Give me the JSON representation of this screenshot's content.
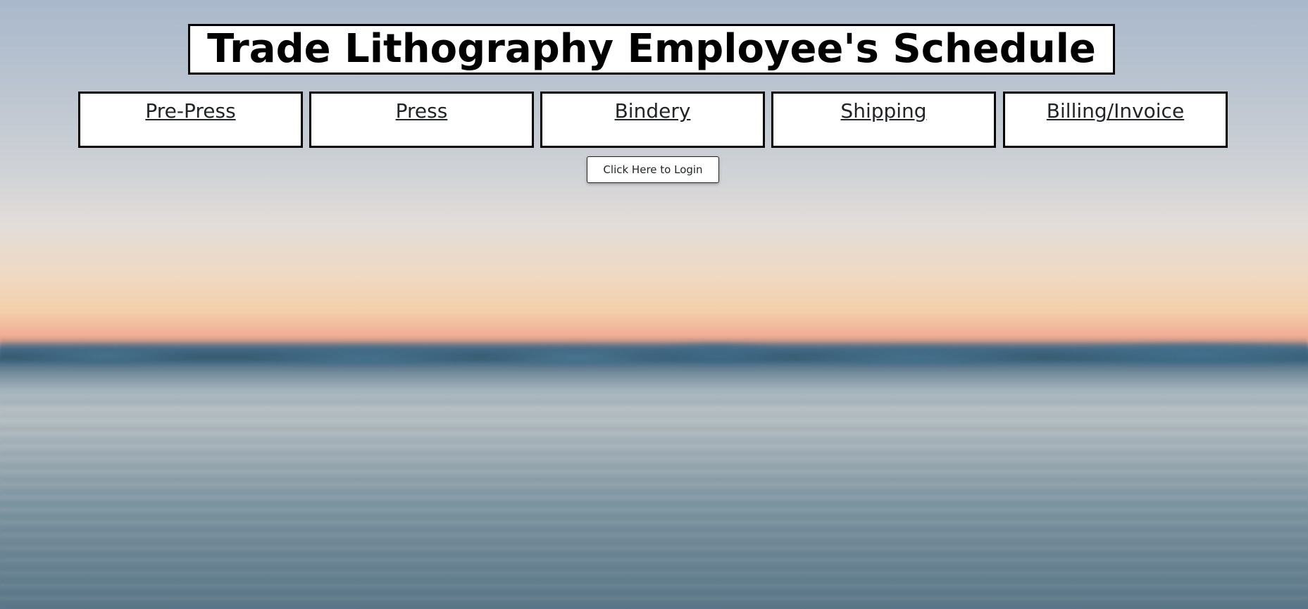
{
  "header": {
    "title": "Trade Lithography Employee's Schedule"
  },
  "nav": {
    "items": [
      {
        "label": "Pre-Press"
      },
      {
        "label": "Press"
      },
      {
        "label": "Bindery"
      },
      {
        "label": "Shipping"
      },
      {
        "label": "Billing/Invoice"
      }
    ]
  },
  "login": {
    "button_label": "Click Here to Login"
  },
  "background": {
    "description_icon": "lake-sunset-background",
    "colors": {
      "sky_top": "#a9b8cb",
      "horizon_glow": "#efa78f",
      "water": "#6f8896"
    }
  }
}
